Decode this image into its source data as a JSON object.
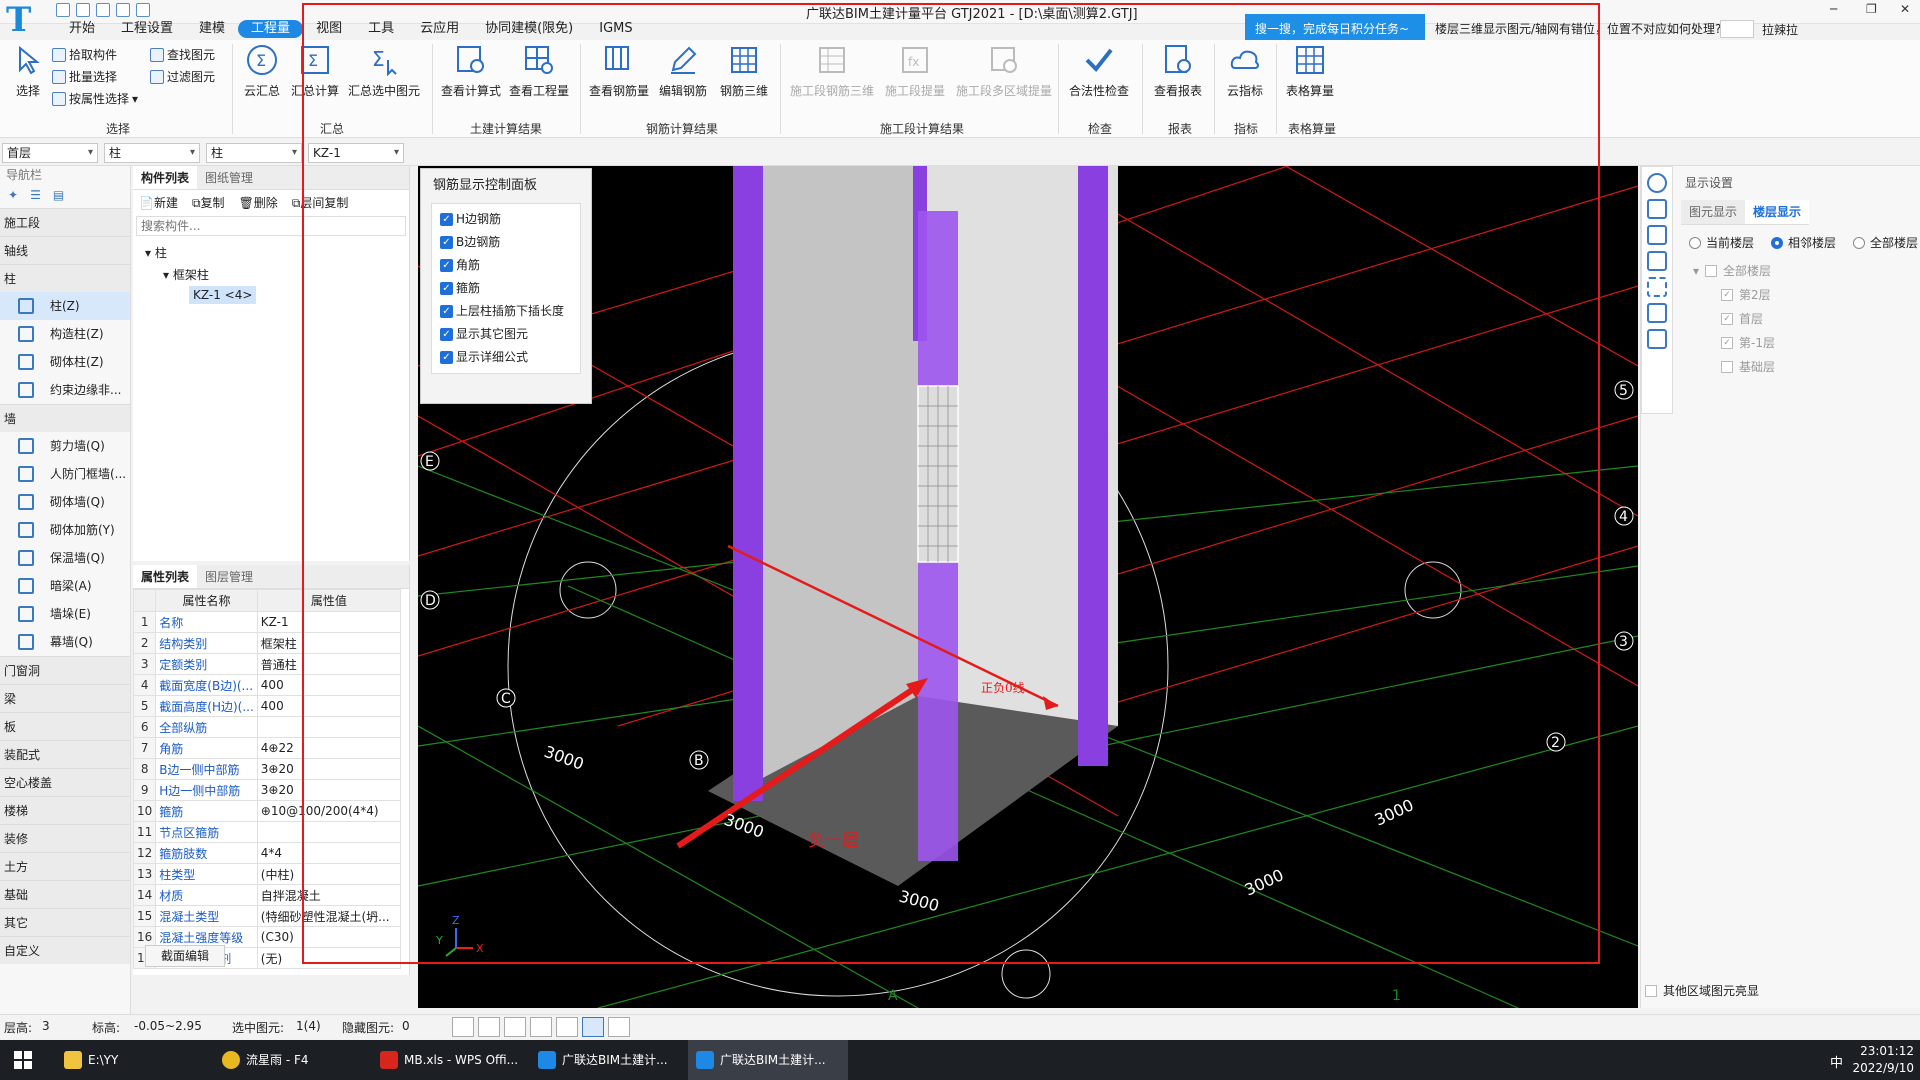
{
  "app": {
    "logo": "T",
    "title": "广联达BIM土建计量平台 GTJ2021 - [D:\\桌面\\测算2.GTJ]",
    "notice": "搜一搜，完成每日积分任务~",
    "faq": "楼层三维显示图元/轴网有错位，位置不对应如何处理?",
    "user": "拉辣拉"
  },
  "menu": [
    "开始",
    "工程设置",
    "建模",
    "工程量",
    "视图",
    "工具",
    "云应用",
    "协同建模(限免)",
    "IGMS"
  ],
  "menu_active": "工程量",
  "ribbon": {
    "select_group": {
      "label": "选择",
      "big": "选择",
      "small": [
        "拾取构件",
        "批量选择",
        "按属性选择",
        "查找图元",
        "过滤图元"
      ]
    },
    "sum_group": {
      "label": "汇总",
      "buttons": [
        "云汇总",
        "汇总计算",
        "汇总选中图元"
      ]
    },
    "civil_group": {
      "label": "土建计算结果",
      "buttons": [
        "查看计算式",
        "查看工程量"
      ]
    },
    "rebar_group": {
      "label": "钢筋计算结果",
      "buttons": [
        "查看钢筋量",
        "编辑钢筋",
        "钢筋三维"
      ]
    },
    "stage_group": {
      "label": "施工段计算结果",
      "buttons": [
        "施工段钢筋三维",
        "施工段提量",
        "施工段多区域提量"
      ]
    },
    "check_group": {
      "label": "检查",
      "buttons": [
        "合法性检查"
      ]
    },
    "report_group": {
      "label": "报表",
      "buttons": [
        "查看报表"
      ]
    },
    "index_group": {
      "label": "指标",
      "buttons": [
        "云指标"
      ]
    },
    "table_group": {
      "label": "表格算量",
      "buttons": [
        "表格算量"
      ]
    }
  },
  "dropdowns": [
    "首层",
    "柱",
    "柱",
    "KZ-1"
  ],
  "nav": {
    "title": "导航栏",
    "categories_top": [
      "施工段",
      "轴线",
      "柱"
    ],
    "column_items": [
      "柱(Z)",
      "构造柱(Z)",
      "砌体柱(Z)",
      "约束边缘非..."
    ],
    "wall_cat": "墙",
    "wall_items": [
      "剪力墙(Q)",
      "人防门框墙(...",
      "砌体墙(Q)",
      "砌体加筋(Y)",
      "保温墙(Q)",
      "暗梁(A)",
      "墙垛(E)",
      "幕墙(Q)"
    ],
    "categories_bottom": [
      "门窗洞",
      "梁",
      "板",
      "装配式",
      "空心楼盖",
      "楼梯",
      "装修",
      "土方",
      "基础",
      "其它",
      "自定义"
    ]
  },
  "component_list": {
    "tabs": [
      "构件列表",
      "图纸管理"
    ],
    "toolbar": [
      "新建",
      "复制",
      "删除",
      "层间复制"
    ],
    "search_placeholder": "搜索构件...",
    "tree": {
      "root": "柱",
      "group": "框架柱",
      "item": "KZ-1 <4>"
    }
  },
  "properties": {
    "tabs": [
      "属性列表",
      "图层管理"
    ],
    "headers": [
      "属性名称",
      "属性值"
    ],
    "rows": [
      [
        "1",
        "名称",
        "KZ-1"
      ],
      [
        "2",
        "结构类别",
        "框架柱"
      ],
      [
        "3",
        "定额类别",
        "普通柱"
      ],
      [
        "4",
        "截面宽度(B边)(...",
        "400"
      ],
      [
        "5",
        "截面高度(H边)(...",
        "400"
      ],
      [
        "6",
        "全部纵筋",
        ""
      ],
      [
        "7",
        "角筋",
        "4⊕22"
      ],
      [
        "8",
        "B边一侧中部筋",
        "3⊕20"
      ],
      [
        "9",
        "H边一侧中部筋",
        "3⊕20"
      ],
      [
        "10",
        "箍筋",
        "⊕10@100/200(4*4)"
      ],
      [
        "11",
        "节点区箍筋",
        ""
      ],
      [
        "12",
        "箍筋肢数",
        "4*4"
      ],
      [
        "13",
        "柱类型",
        "(中柱)"
      ],
      [
        "14",
        "材质",
        "自拌混凝土"
      ],
      [
        "15",
        "混凝土类型",
        "(特细砂塑性混凝土(坍..."
      ],
      [
        "16",
        "混凝土强度等级",
        "(C30)"
      ],
      [
        "17",
        "混凝土外加剂",
        "(无)"
      ]
    ],
    "section_edit": "截面编辑"
  },
  "rebar_panel": {
    "title": "钢筋显示控制面板",
    "options": [
      "H边钢筋",
      "B边钢筋",
      "角筋",
      "箍筋",
      "上层柱插筋下插长度",
      "显示其它图元",
      "显示详细公式"
    ]
  },
  "viewport": {
    "axis_labels": [
      "E",
      "D",
      "C",
      "B",
      "A",
      "5",
      "4",
      "3",
      "2",
      "1"
    ],
    "dims": [
      "3000",
      "3000",
      "3000",
      "3000",
      "3000"
    ],
    "annotation_zero": "正负0线",
    "annotation_floor": "负一层",
    "axis_xyz": [
      "X",
      "Y",
      "Z"
    ]
  },
  "display": {
    "title": "显示设置",
    "tabs": [
      "图元显示",
      "楼层显示"
    ],
    "scope": [
      "当前楼层",
      "相邻楼层",
      "全部楼层"
    ],
    "scope_selected": "相邻楼层",
    "floors_root": "全部楼层",
    "floors": [
      "第2层",
      "首层",
      "第-1层",
      "基础层"
    ],
    "other_region": "其他区域图元亮显"
  },
  "status": {
    "floor_height_label": "层高:",
    "floor_height": "3",
    "elev_label": "标高:",
    "elev": "-0.05~2.95",
    "selected_label": "选中图元:",
    "selected": "1(4)",
    "hidden_label": "隐藏图元:",
    "hidden": "0"
  },
  "taskbar": {
    "items": [
      "E:\\YY",
      "流星雨 - F4",
      "MB.xls - WPS Offi...",
      "广联达BIM土建计...",
      "广联达BIM土建计..."
    ],
    "ime": "中",
    "time": "23:01:12",
    "date": "2022/9/10"
  },
  "colors": {
    "accent": "#1e88e5",
    "column": "#8a3fe0",
    "grid_red": "#d11818",
    "grid_green": "#1e8a1e",
    "annotation": "#e51b1b"
  }
}
